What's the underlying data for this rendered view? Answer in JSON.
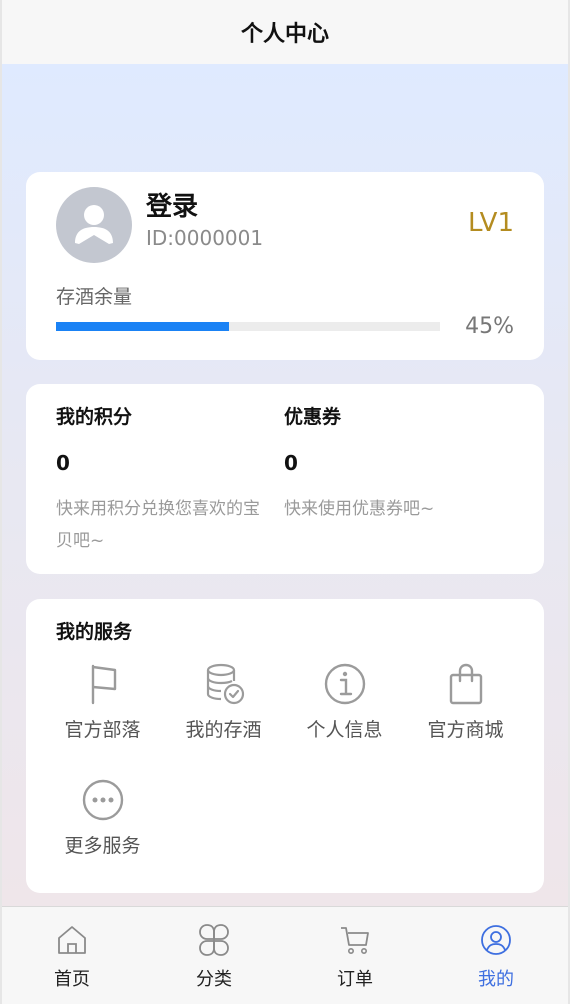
{
  "header": {
    "title": "个人中心"
  },
  "profile": {
    "name": "登录",
    "id_text": "ID:0000001",
    "level": "LV1",
    "wine_label": "存酒余量",
    "progress_percent": 45,
    "progress_text": "45%",
    "accent": "#1a82f5",
    "level_color": "#b48c20"
  },
  "points": {
    "points_title": "我的积分",
    "points_value": "0",
    "points_desc": "快来用积分兑换您喜欢的宝贝吧~",
    "coupon_title": "优惠券",
    "coupon_value": "0",
    "coupon_desc": "快来使用优惠券吧~"
  },
  "services": {
    "title": "我的服务",
    "items": [
      {
        "label": "官方部落",
        "icon": "flag-icon"
      },
      {
        "label": "我的存酒",
        "icon": "storage-check-icon"
      },
      {
        "label": "个人信息",
        "icon": "info-icon"
      },
      {
        "label": "官方商城",
        "icon": "shopping-bag-icon"
      },
      {
        "label": "更多服务",
        "icon": "more-icon"
      }
    ]
  },
  "tabbar": {
    "active_color": "#3e6fe0",
    "items": [
      {
        "label": "首页",
        "icon": "home-icon"
      },
      {
        "label": "分类",
        "icon": "category-icon"
      },
      {
        "label": "订单",
        "icon": "cart-icon"
      },
      {
        "label": "我的",
        "icon": "user-icon"
      }
    ]
  }
}
